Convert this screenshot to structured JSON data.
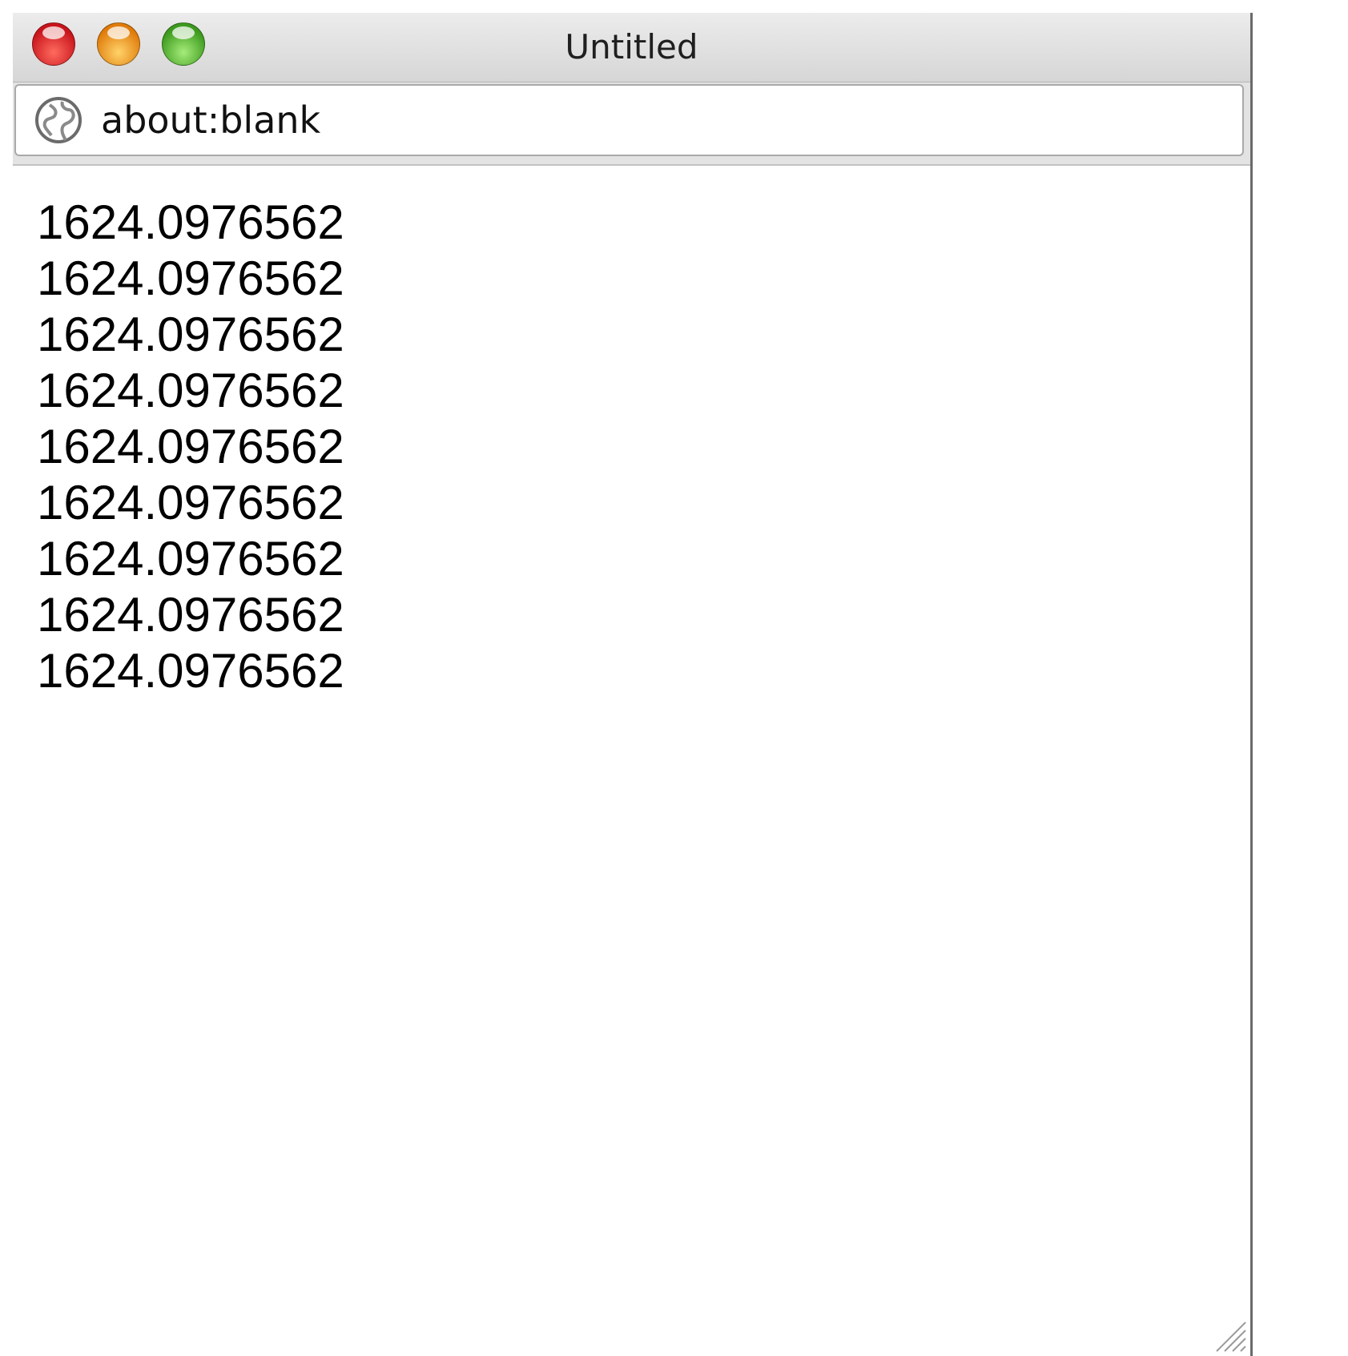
{
  "window": {
    "title": "Untitled",
    "controls": [
      "close",
      "minimize",
      "maximize"
    ]
  },
  "address_bar": {
    "icon": "globe-icon",
    "value": "about:blank"
  },
  "content": {
    "lines": [
      "1624.0976562",
      "1624.0976562",
      "1624.0976562",
      "1624.0976562",
      "1624.0976562",
      "1624.0976562",
      "1624.0976562",
      "1624.0976562",
      "1624.0976562"
    ]
  },
  "colors": {
    "close": "#e0312a",
    "minimize": "#f5a623",
    "maximize": "#5cbf2a"
  }
}
